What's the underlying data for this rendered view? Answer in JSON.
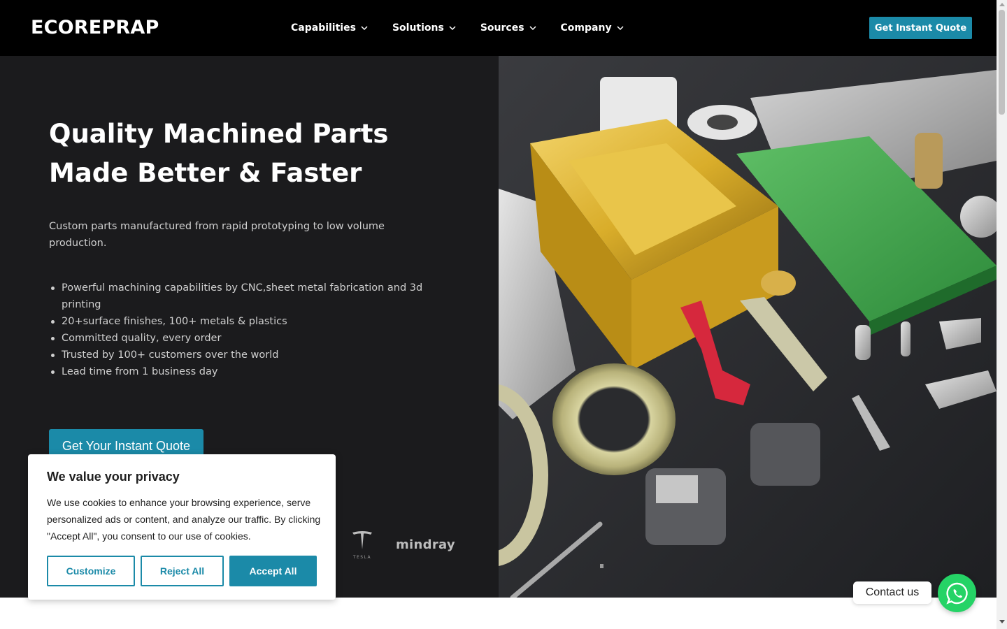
{
  "header": {
    "logo": "ECOREPRAP",
    "nav": [
      {
        "label": "Capabilities"
      },
      {
        "label": "Solutions"
      },
      {
        "label": "Sources"
      },
      {
        "label": "Company"
      }
    ],
    "cta_label": "Get Instant Quote"
  },
  "hero": {
    "title_line1": "Quality Machined Parts",
    "title_line2": "Made Better & Faster",
    "subtitle": "Custom parts manufactured from rapid prototyping to low volume production.",
    "features": [
      "Powerful machining capabilities by CNC,sheet metal fabrication and 3d printing",
      "20+surface finishes, 100+ metals & plastics",
      "Committed quality, every order",
      "Trusted by 100+ customers over the world",
      "Lead time from 1 business day"
    ],
    "cta_label": "Get Your Instant Quote",
    "client_logos": {
      "tesla": "TESLA",
      "mindray": "mindray"
    }
  },
  "cookie": {
    "title": "We value your privacy",
    "text": "We use cookies to enhance your browsing experience, serve personalized ads or content, and analyze our traffic. By clicking \"Accept All\", you consent to our use of cookies.",
    "customize_label": "Customize",
    "reject_label": "Reject All",
    "accept_label": "Accept All"
  },
  "contact": {
    "label": "Contact us",
    "icon": "whatsapp-icon"
  },
  "colors": {
    "accent": "#1b8aa8",
    "header_bg": "#000000",
    "hero_bg": "#1b1b1d",
    "whatsapp": "#25d366"
  }
}
